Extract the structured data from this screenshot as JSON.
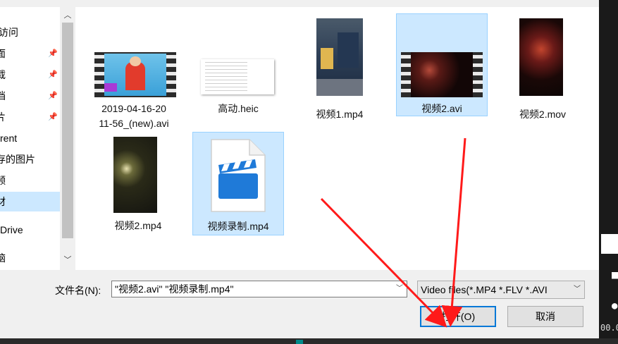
{
  "nav": {
    "items": [
      {
        "label": "访问",
        "pinned": false
      },
      {
        "label": "面",
        "pinned": true
      },
      {
        "label": "载",
        "pinned": true
      },
      {
        "label": "档",
        "pinned": true
      },
      {
        "label": "片",
        "pinned": true
      },
      {
        "label": "rent",
        "pinned": false
      },
      {
        "label": "存的图片",
        "pinned": false
      },
      {
        "label": "频",
        "pinned": false
      },
      {
        "label": "材",
        "pinned": false,
        "selected": true
      },
      {
        "label": "Drive",
        "pinned": false
      },
      {
        "label": "脑",
        "pinned": false
      }
    ]
  },
  "files": [
    {
      "name": "2019-04-16-20\n11-56_(new).avi",
      "line1": "2019-04-16-20",
      "line2": "11-56_(new).avi",
      "type": "video-film",
      "selected": false
    },
    {
      "name": "高动.heic",
      "type": "image-doc",
      "selected": false
    },
    {
      "name": "视频1.mp4",
      "type": "video-portrait",
      "selected": false
    },
    {
      "name": "视频2.avi",
      "type": "video-film",
      "selected": true
    },
    {
      "name": "视频2.mov",
      "type": "video-portrait",
      "selected": false
    },
    {
      "name": "视频2.mp4",
      "type": "video-portrait",
      "selected": false
    },
    {
      "name": "视频录制.mp4",
      "type": "video-icon",
      "selected": true
    }
  ],
  "filename": {
    "label": "文件名(N):",
    "value": "\"视频2.avi\" \"视频录制.mp4\""
  },
  "filetype": {
    "value": "Video files(*.MP4 *.FLV *.AVI"
  },
  "buttons": {
    "open": "打开(O)",
    "cancel": "取消"
  },
  "side": {
    "time": "00.0"
  },
  "colors": {
    "selection": "#cce8ff",
    "accent": "#0078d7",
    "annotation_arrow": "#ff1a1a"
  }
}
